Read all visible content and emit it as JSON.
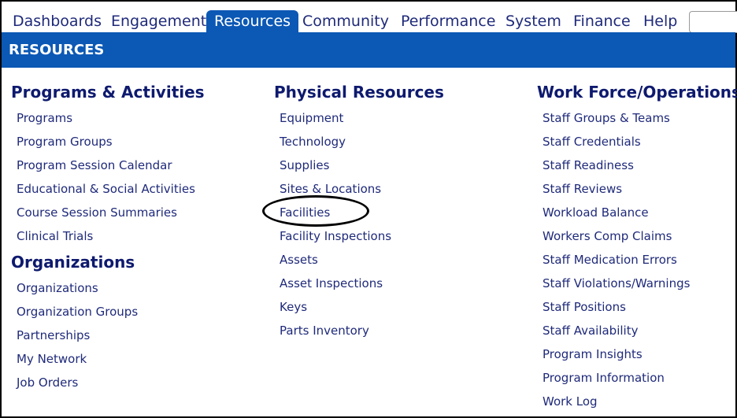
{
  "nav": {
    "tabs": [
      {
        "label": "Dashboards"
      },
      {
        "label": "Engagement"
      },
      {
        "label": "Resources"
      },
      {
        "label": "Community"
      },
      {
        "label": "Performance"
      },
      {
        "label": "System"
      },
      {
        "label": "Finance"
      },
      {
        "label": "Help"
      }
    ],
    "active_tab": "Resources"
  },
  "band": {
    "title": "RESOURCES"
  },
  "columns": [
    {
      "sections": [
        {
          "heading": "Programs & Activities",
          "links": [
            "Programs",
            "Program Groups",
            "Program Session Calendar",
            "Educational & Social Activities",
            "Course Session Summaries",
            "Clinical Trials"
          ]
        },
        {
          "heading": "Organizations",
          "links": [
            "Organizations",
            "Organization Groups",
            "Partnerships",
            "My Network",
            "Job Orders"
          ]
        }
      ]
    },
    {
      "sections": [
        {
          "heading": "Physical Resources",
          "links": [
            "Equipment",
            "Technology",
            "Supplies",
            "Sites & Locations",
            "Facilities",
            "Facility Inspections",
            "Assets",
            "Asset Inspections",
            "Keys",
            "Parts Inventory"
          ]
        }
      ]
    },
    {
      "sections": [
        {
          "heading": "Work Force/Operations",
          "links": [
            "Staff Groups & Teams",
            "Staff Credentials",
            "Staff Readiness",
            "Staff Reviews",
            "Workload Balance",
            "Workers Comp Claims",
            "Staff Medication Errors",
            "Staff Violations/Warnings",
            "Staff Positions",
            "Staff Availability",
            "Program Insights",
            "Program Information",
            "Work Log"
          ]
        }
      ]
    }
  ],
  "colors": {
    "brand": "#0b58b5",
    "heading": "#0e1a6e",
    "link": "#1f2a7a"
  }
}
